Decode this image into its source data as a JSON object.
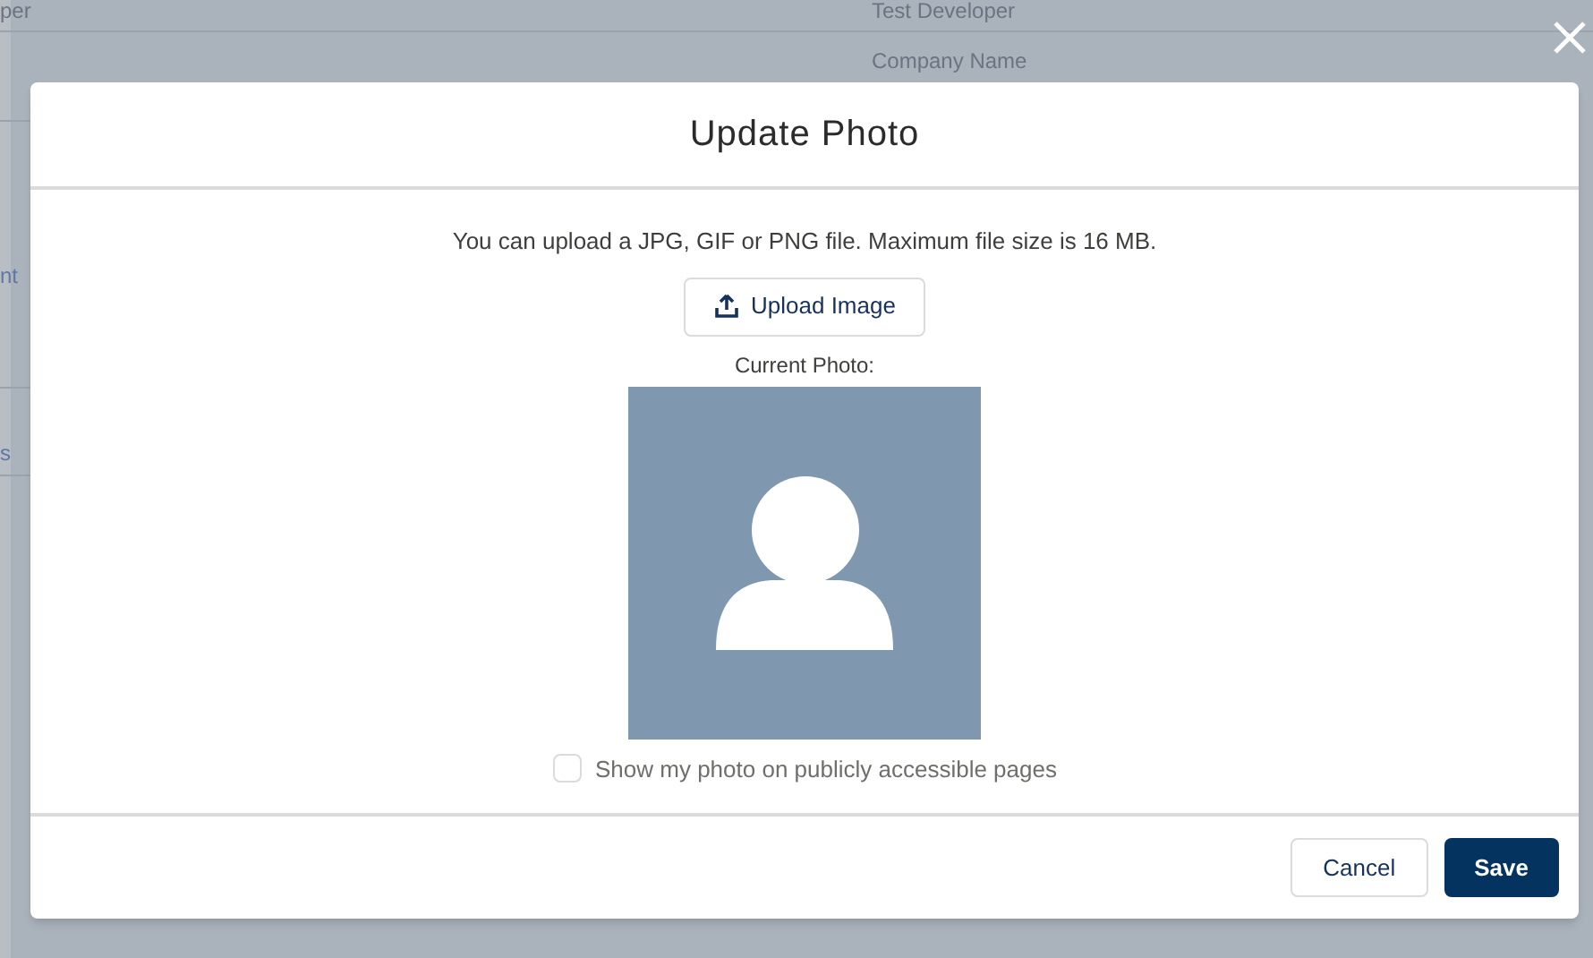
{
  "background": {
    "texts_left": [
      "per",
      "nt",
      "s"
    ],
    "texts_center": [
      "Test Developer",
      "Company Name"
    ]
  },
  "modal": {
    "title": "Update Photo",
    "instructions": "You can upload a JPG, GIF or PNG file. Maximum file size is 16 MB.",
    "upload_button": "Upload Image",
    "current_photo_label": "Current Photo:",
    "public_checkbox": {
      "label": "Show my photo on publicly accessible pages",
      "checked": false
    },
    "buttons": [
      {
        "label": "Cancel",
        "kind": "neutral"
      },
      {
        "label": "Save",
        "kind": "brand"
      }
    ]
  }
}
